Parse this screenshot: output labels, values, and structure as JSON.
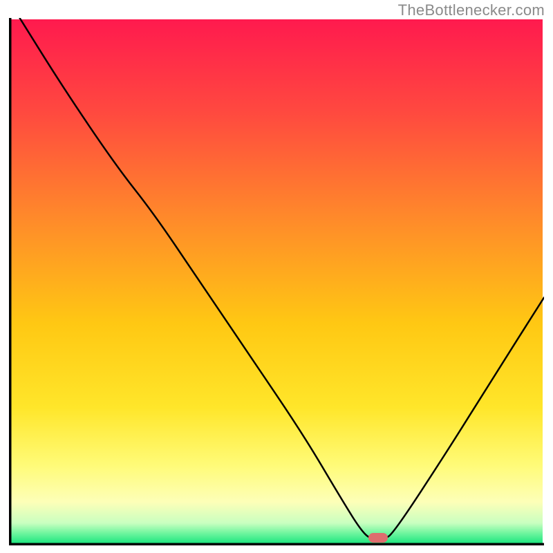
{
  "attribution": "TheBottlenecker.com",
  "chart_data": {
    "type": "line",
    "title": "",
    "xlabel": "",
    "ylabel": "",
    "xlim": [
      0,
      100
    ],
    "ylim": [
      0,
      100
    ],
    "series": [
      {
        "name": "curve",
        "x": [
          2,
          10,
          20,
          27,
          35,
          45,
          55,
          62,
          66,
          68,
          70,
          72,
          82,
          90,
          100
        ],
        "y": [
          100,
          87,
          72,
          63,
          51,
          36,
          21,
          9,
          2.5,
          1,
          1,
          2.5,
          18,
          31,
          47
        ]
      }
    ],
    "marker": {
      "x": 69,
      "y": 1.5
    },
    "gradient_stops": [
      {
        "pct": 0,
        "color": "#ff1a4e"
      },
      {
        "pct": 18,
        "color": "#ff4a3f"
      },
      {
        "pct": 38,
        "color": "#ff8a2a"
      },
      {
        "pct": 58,
        "color": "#ffc813"
      },
      {
        "pct": 74,
        "color": "#ffe62a"
      },
      {
        "pct": 85,
        "color": "#fffb78"
      },
      {
        "pct": 92,
        "color": "#fdffb8"
      },
      {
        "pct": 96,
        "color": "#c9ffc0"
      },
      {
        "pct": 98,
        "color": "#6cf59d"
      },
      {
        "pct": 100,
        "color": "#18e67e"
      }
    ]
  }
}
